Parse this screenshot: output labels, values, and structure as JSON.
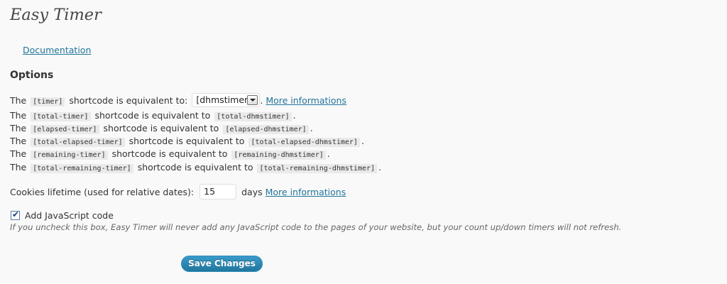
{
  "page": {
    "title": "Easy Timer",
    "documentation_link": "Documentation",
    "options_heading": "Options"
  },
  "options": {
    "timer_row": {
      "prefix": "The",
      "code": "[timer]",
      "middle": "shortcode is equivalent to:",
      "select_value": "[dhmstimer]",
      "suffix": ".",
      "link": "More informations"
    },
    "equivalences": [
      {
        "prefix": "The",
        "code": "[total-timer]",
        "middle": "shortcode is equivalent to",
        "target": "[total-dhmstimer]",
        "suffix": "."
      },
      {
        "prefix": "The",
        "code": "[elapsed-timer]",
        "middle": "shortcode is equivalent to",
        "target": "[elapsed-dhmstimer]",
        "suffix": "."
      },
      {
        "prefix": "The",
        "code": "[total-elapsed-timer]",
        "middle": "shortcode is equivalent to",
        "target": "[total-elapsed-dhmstimer]",
        "suffix": "."
      },
      {
        "prefix": "The",
        "code": "[remaining-timer]",
        "middle": "shortcode is equivalent to",
        "target": "[remaining-dhmstimer]",
        "suffix": "."
      },
      {
        "prefix": "The",
        "code": "[total-remaining-timer]",
        "middle": "shortcode is equivalent to",
        "target": "[total-remaining-dhmstimer]",
        "suffix": "."
      }
    ],
    "cookies": {
      "label": "Cookies lifetime (used for relative dates):",
      "value": "15",
      "unit": "days",
      "link": "More informations"
    },
    "javascript": {
      "label": "Add JavaScript code",
      "checked": true,
      "check_glyph": "✔",
      "hint": "If you uncheck this box, Easy Timer will never add any JavaScript code to the pages of your website, but your count up/down timers will not refresh."
    }
  },
  "actions": {
    "save_label": "Save Changes"
  },
  "colors": {
    "link": "#21759b",
    "button": "#21759b",
    "background": "#f9f9f9"
  }
}
